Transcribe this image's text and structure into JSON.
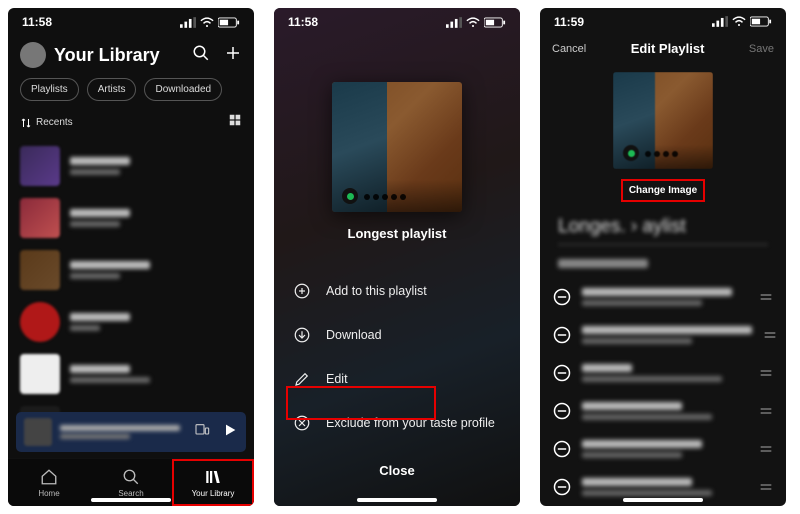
{
  "screen1": {
    "time": "11:58",
    "header_title": "Your Library",
    "chips": {
      "playlists": "Playlists",
      "artists": "Artists",
      "downloaded": "Downloaded"
    },
    "sort_label": "Recents",
    "tabs": {
      "home": "Home",
      "search": "Search",
      "library": "Your Library"
    }
  },
  "screen2": {
    "time": "11:58",
    "playlist_name": "Longest playlist",
    "menu": {
      "add": "Add to this playlist",
      "download": "Download",
      "edit": "Edit",
      "exclude": "Exclude from your taste profile"
    },
    "close": "Close"
  },
  "screen3": {
    "time": "11:59",
    "cancel": "Cancel",
    "title": "Edit Playlist",
    "save": "Save",
    "change_image": "Change Image",
    "playlist_title_display": "Longes.  › aylist"
  }
}
